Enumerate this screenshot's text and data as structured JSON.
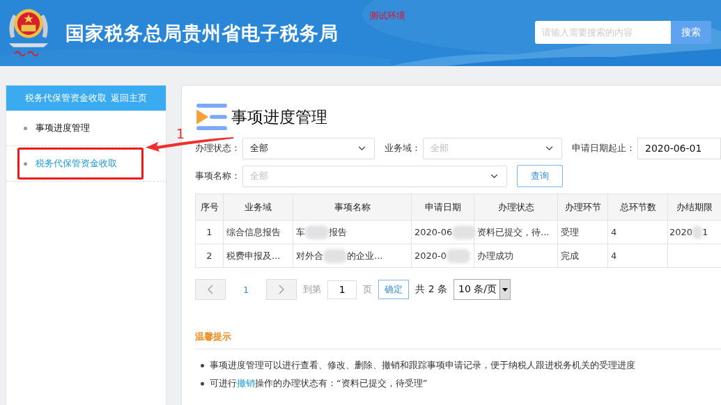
{
  "header": {
    "title": "国家税务总局贵州省电子税务局",
    "env_badge": "测试环境",
    "search": {
      "placeholder": "请输入需要搜索的内容",
      "button": "搜索"
    }
  },
  "sidebar": {
    "title": "税务代保管资金收取",
    "home_link": "返回主页",
    "items": [
      {
        "label": "事项进度管理",
        "selected": false,
        "highlighted": false
      },
      {
        "label": "税务代保管资金收取",
        "selected": true,
        "highlighted": true
      }
    ]
  },
  "annotation": {
    "number": "1"
  },
  "page": {
    "title": "事项进度管理"
  },
  "filters": [
    {
      "kind": "select",
      "label": "办理状态：",
      "value": "全部"
    },
    {
      "kind": "select",
      "label": "业务域：",
      "placeholder": "全部"
    },
    {
      "kind": "input",
      "label": "申请日期起止：",
      "value": "2020-06-01"
    },
    {
      "kind": "select",
      "label": "事项名称：",
      "placeholder": "全部"
    }
  ],
  "query_button": "查询",
  "table": {
    "columns": [
      "序号",
      "业务域",
      "事项名称",
      "申请日期",
      "办理状态",
      "办理环节",
      "总环节数",
      "办结期限"
    ],
    "rows": [
      [
        {
          "text": "1"
        },
        {
          "text": "综合信息报告"
        },
        {
          "before": "车",
          "after": "报告"
        },
        {
          "before": "2020-06"
        },
        {
          "text": "资料已提交，待..."
        },
        {
          "text": "受理"
        },
        {
          "text": "4"
        },
        {
          "before": "2020",
          "after": "1"
        }
      ],
      [
        {
          "text": "2"
        },
        {
          "text": "税费申报及..."
        },
        {
          "before": "对外合",
          "after": "的企业..."
        },
        {
          "before": "2020-0"
        },
        {
          "text": "办理成功"
        },
        {
          "text": "完成"
        },
        {
          "text": "4"
        }
      ]
    ]
  },
  "pagination": {
    "pages": [
      "1"
    ],
    "goto_label": "到第",
    "goto_value": "1",
    "page_unit": "页",
    "confirm": "确定",
    "total": "共 2 条",
    "page_size": "10 条/页"
  },
  "tips": {
    "title": "温馨提示",
    "items": [
      {
        "parts": [
          {
            "kind": "plain",
            "text": "事项进度管理可以进行查看、修改、删除、撤销和跟踪事项申请记录，便于纳税人跟进税务机关的受理进度"
          }
        ]
      },
      {
        "parts": [
          {
            "kind": "plain",
            "text": "可进行"
          },
          {
            "kind": "link",
            "text": "撤销"
          },
          {
            "kind": "plain",
            "text": "操作的办理状态有：“资料已提交，待受理”"
          }
        ]
      }
    ]
  }
}
